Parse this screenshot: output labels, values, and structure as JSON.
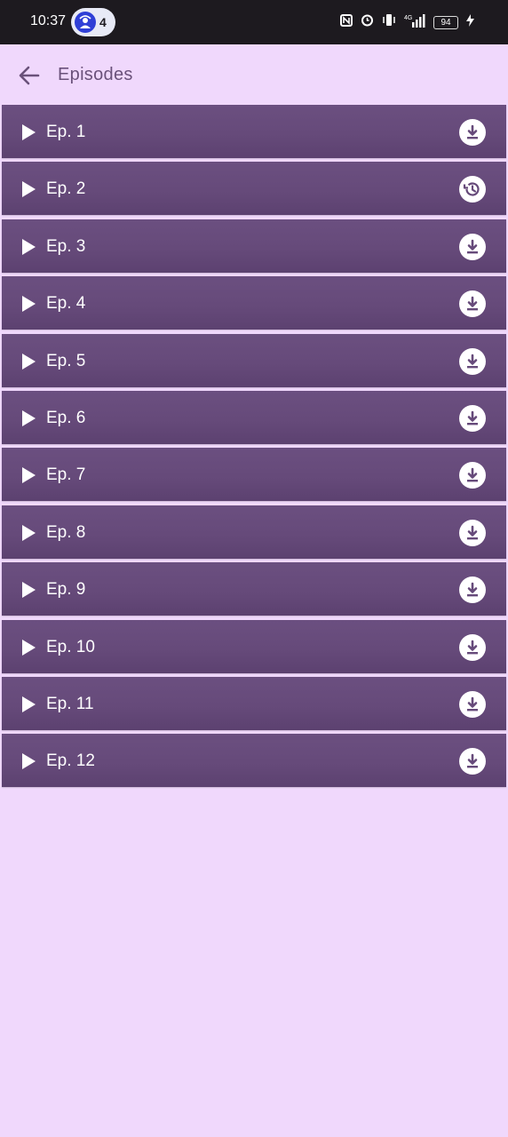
{
  "status_bar": {
    "time": "10:37",
    "notification_count": "4",
    "battery": "94",
    "network": "4G"
  },
  "app_bar": {
    "title": "Episodes",
    "back_icon": "arrow-back-icon"
  },
  "episodes": [
    {
      "label": "Ep. 1",
      "action": "download"
    },
    {
      "label": "Ep. 2",
      "action": "history"
    },
    {
      "label": "Ep. 3",
      "action": "download"
    },
    {
      "label": "Ep. 4",
      "action": "download"
    },
    {
      "label": "Ep. 5",
      "action": "download"
    },
    {
      "label": "Ep. 6",
      "action": "download"
    },
    {
      "label": "Ep. 7",
      "action": "download"
    },
    {
      "label": "Ep. 8",
      "action": "download"
    },
    {
      "label": "Ep. 9",
      "action": "download"
    },
    {
      "label": "Ep. 10",
      "action": "download"
    },
    {
      "label": "Ep. 11",
      "action": "download"
    },
    {
      "label": "Ep. 12",
      "action": "download"
    }
  ],
  "colors": {
    "background": "#f0d8fc",
    "row": "#664a7a",
    "title": "#6a517a",
    "status_bar": "#1d1a1f"
  }
}
